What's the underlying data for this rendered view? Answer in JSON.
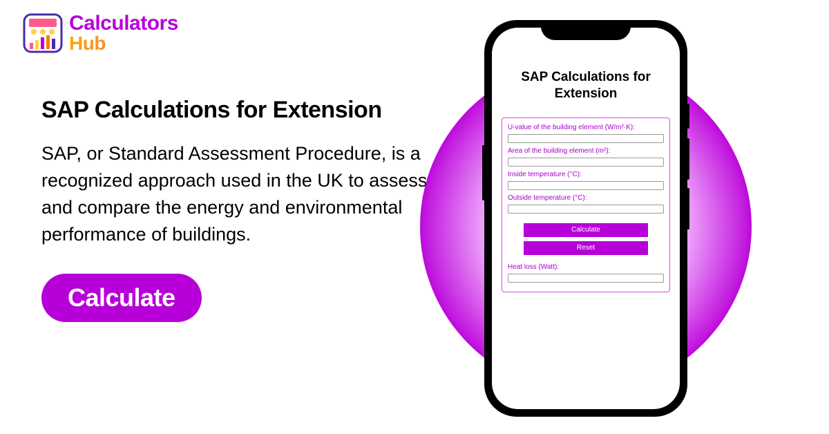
{
  "logo": {
    "line1": "Calculators",
    "line2": "Hub"
  },
  "page": {
    "title": "SAP Calculations for Extension",
    "description": "SAP, or Standard Assessment Procedure, is a recognized approach used in the UK to assess and compare the energy and environmental performance of buildings."
  },
  "cta": {
    "label": "Calculate"
  },
  "phone": {
    "title": "SAP Calculations for Extension",
    "form": {
      "fields": [
        {
          "label": "U-value of the building element (W/m²·K):",
          "value": ""
        },
        {
          "label": "Area of the building element (m²):",
          "value": ""
        },
        {
          "label": "Inside temperature (°C):",
          "value": ""
        },
        {
          "label": "Outside temperature (°C):",
          "value": ""
        }
      ],
      "calculate": "Calculate",
      "reset": "Reset",
      "result_label": "Heat loss (Watt):",
      "result_value": ""
    }
  }
}
